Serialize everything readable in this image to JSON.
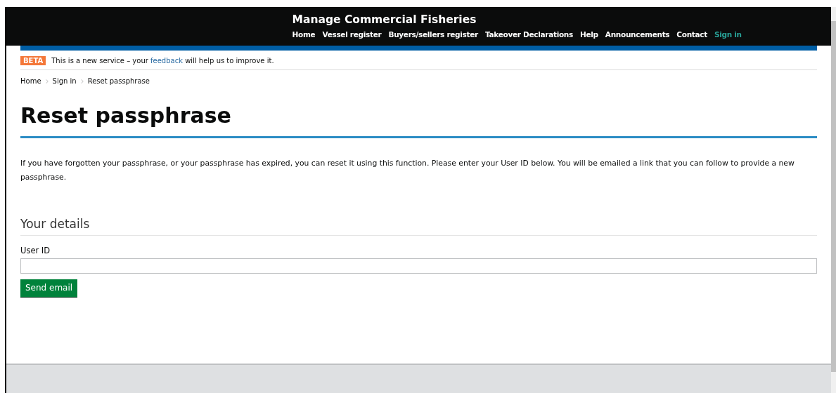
{
  "header": {
    "title": "Manage Commercial Fisheries",
    "nav": [
      {
        "label": "Home",
        "selected": false
      },
      {
        "label": "Vessel register",
        "selected": false
      },
      {
        "label": "Buyers/sellers register",
        "selected": false
      },
      {
        "label": "Takeover Declarations",
        "selected": false
      },
      {
        "label": "Help",
        "selected": false
      },
      {
        "label": "Announcements",
        "selected": false
      },
      {
        "label": "Contact",
        "selected": false
      },
      {
        "label": "Sign in",
        "selected": true
      }
    ]
  },
  "phase_banner": {
    "tag": "BETA",
    "before": "This is a new service – your",
    "link": "feedback",
    "after": "will help us to improve it."
  },
  "breadcrumbs": [
    "Home",
    "Sign in",
    "Reset passphrase"
  ],
  "heading": "Reset passphrase",
  "intro": "If you have forgotten your passphrase, or your passphrase has expired, you can reset it using this function. Please enter your User ID below. You will be emailed a link that you can follow to provide a new passphrase.",
  "form": {
    "legend": "Your details",
    "field_label": "User ID",
    "button": "Send email"
  }
}
